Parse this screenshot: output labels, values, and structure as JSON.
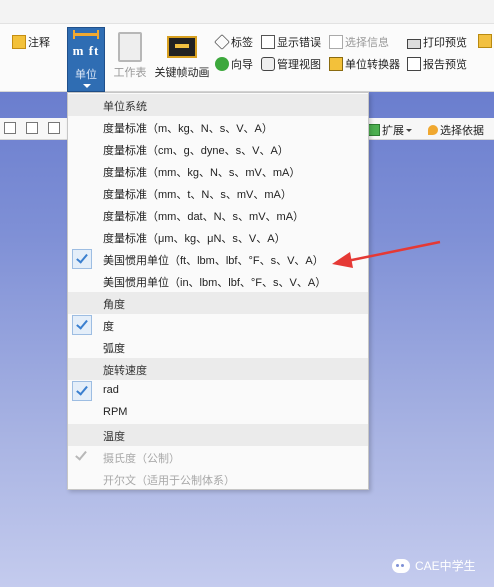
{
  "ribbon": {
    "annotate": "注释",
    "units_button": "单位",
    "workbench": "工作表",
    "keyframe_animation": "关键帧动画",
    "tags": "标签",
    "show_errors": "显示错误",
    "selection_info": "选择信息",
    "print_preview": "打印预览",
    "wizard": "向导",
    "manage_views": "管理视图",
    "unit_converter": "单位转换器",
    "report_preview": "报告预览",
    "extend": "扩展",
    "select_by": "选择依据"
  },
  "menu": {
    "unit_systems_header": "单位系统",
    "unit_systems": [
      "度量标准（m、kg、N、s、V、A）",
      "度量标准（cm、g、dyne、s、V、A）",
      "度量标准（mm、kg、N、s、mV、mA）",
      "度量标准（mm、t、N、s、mV、mA）",
      "度量标准（mm、dat、N、s、mV、mA）",
      "度量标准（μm、kg、μN、s、V、A）",
      "美国惯用单位（ft、lbm、lbf、°F、s、V、A）",
      "美国惯用单位（in、lbm、lbf、°F、s、V、A）"
    ],
    "angle_header": "角度",
    "angle_options": [
      "度",
      "弧度"
    ],
    "rotational_velocity_header": "旋转速度",
    "rotational_velocity_options": [
      "rad",
      "RPM"
    ],
    "temperature_header": "温度",
    "temperature_options": [
      "摄氏度（公制）",
      "开尔文（适用于公制体系）"
    ]
  },
  "watermark": "CAE中学生",
  "colors": {
    "accent": "#2f6db3",
    "arrow": "#e53935",
    "check": "#3a7fcf"
  }
}
